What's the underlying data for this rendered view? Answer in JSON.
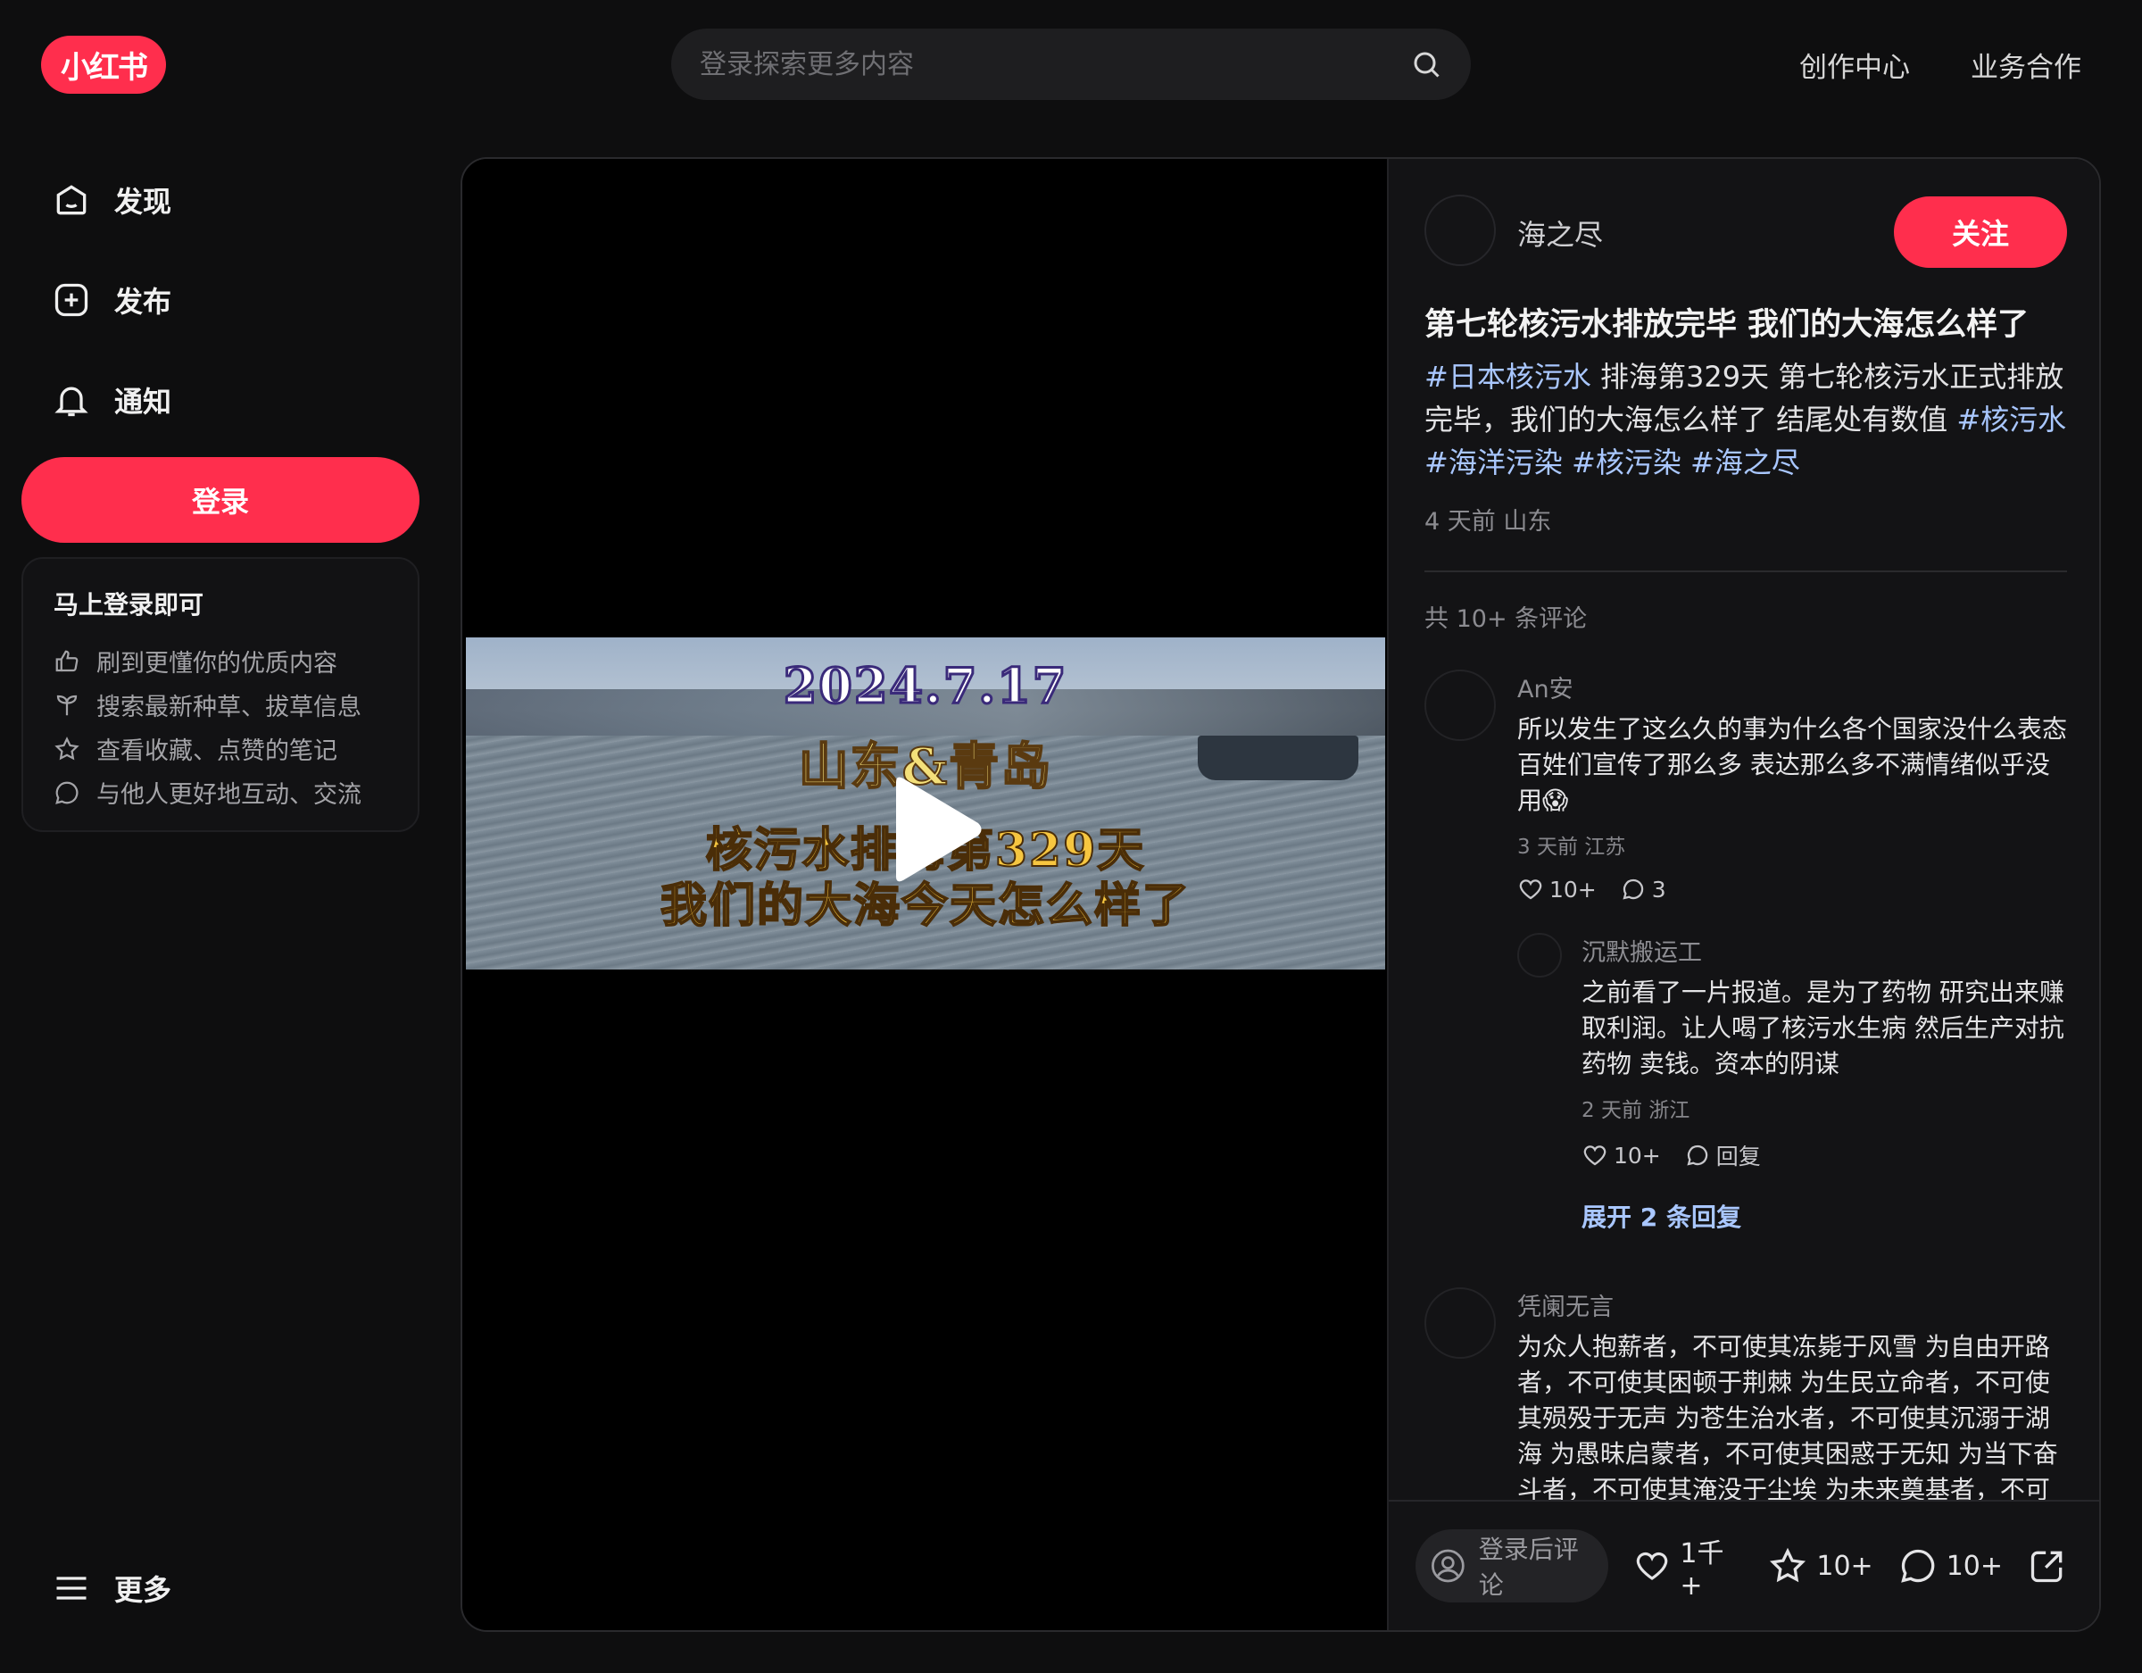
{
  "header": {
    "logo_text": "小红书",
    "search_placeholder": "登录探索更多内容",
    "links": [
      "创作中心",
      "业务合作"
    ]
  },
  "sidebar": {
    "items": [
      {
        "label": "发现",
        "icon": "home-icon"
      },
      {
        "label": "发布",
        "icon": "plus-square-icon"
      },
      {
        "label": "通知",
        "icon": "bell-icon"
      }
    ],
    "login_button": "登录",
    "login_card": {
      "title": "马上登录即可",
      "rows": [
        {
          "text": "刷到更懂你的优质内容",
          "icon": "thumbs-up-icon"
        },
        {
          "text": "搜索最新种草、拔草信息",
          "icon": "sprout-icon"
        },
        {
          "text": "查看收藏、点赞的笔记",
          "icon": "star-icon"
        },
        {
          "text": "与他人更好地互动、交流",
          "icon": "chat-icon"
        }
      ]
    },
    "more_label": "更多"
  },
  "video": {
    "overlay_date": "2024.7.17",
    "overlay_location": "山东&青岛",
    "overlay_line1": "核污水排海第329天",
    "overlay_line2": "我们的大海今天怎么样了"
  },
  "note": {
    "author": "海之尽",
    "follow_label": "关注",
    "title": "第七轮核污水排放完毕 我们的大海怎么样了",
    "desc_tag1": "#日本核污水",
    "desc_text": " 排海第329天 第七轮核污水正式排放完毕，我们的大海怎么样了  结尾处有数值 ",
    "desc_tags_rest": [
      "#核污水",
      "#海洋污染",
      "#核污染",
      "#海之尽"
    ],
    "meta": "4 天前 山东",
    "comment_count": "共 10+ 条评论"
  },
  "comments": [
    {
      "user": "An安",
      "text": "所以发生了这么久的事为什么各个国家没什么表态 百姓们宣传了那么多 表达那么多不满情绪似乎没用😱",
      "time": "3 天前 江苏",
      "likes": "10+",
      "replies": "3",
      "reply": {
        "user": "沉默搬运工",
        "text": "之前看了一片报道。是为了药物 研究出来赚取利润。让人喝了核污水生病 然后生产对抗药物 卖钱。资本的阴谋",
        "time": "2 天前 浙江",
        "likes": "10+",
        "reply_label": "回复"
      },
      "expand_label": "展开 2 条回复"
    },
    {
      "user": "凭阑无言",
      "text": "为众人抱薪者，不可使其冻毙于风雪 为自由开路者，不可使其困顿于荆棘 为生民立命者，不可使其殒殁于无声 为苍生治水者，不可使其沉溺于湖海 为愚昧启蒙者，不可使其困惑于无知 为当下奋斗者，不可使其淹没于尘埃 为未来奠基者，不可使其葬身于黄土 为民请命者"
    }
  ],
  "bottom_bar": {
    "input_placeholder": "登录后评论",
    "likes": "1千+",
    "collects": "10+",
    "comments": "10+"
  },
  "colors": {
    "accent": "#ff2e4d",
    "tag": "#a9c7ff",
    "background": "#0e0e0f"
  }
}
